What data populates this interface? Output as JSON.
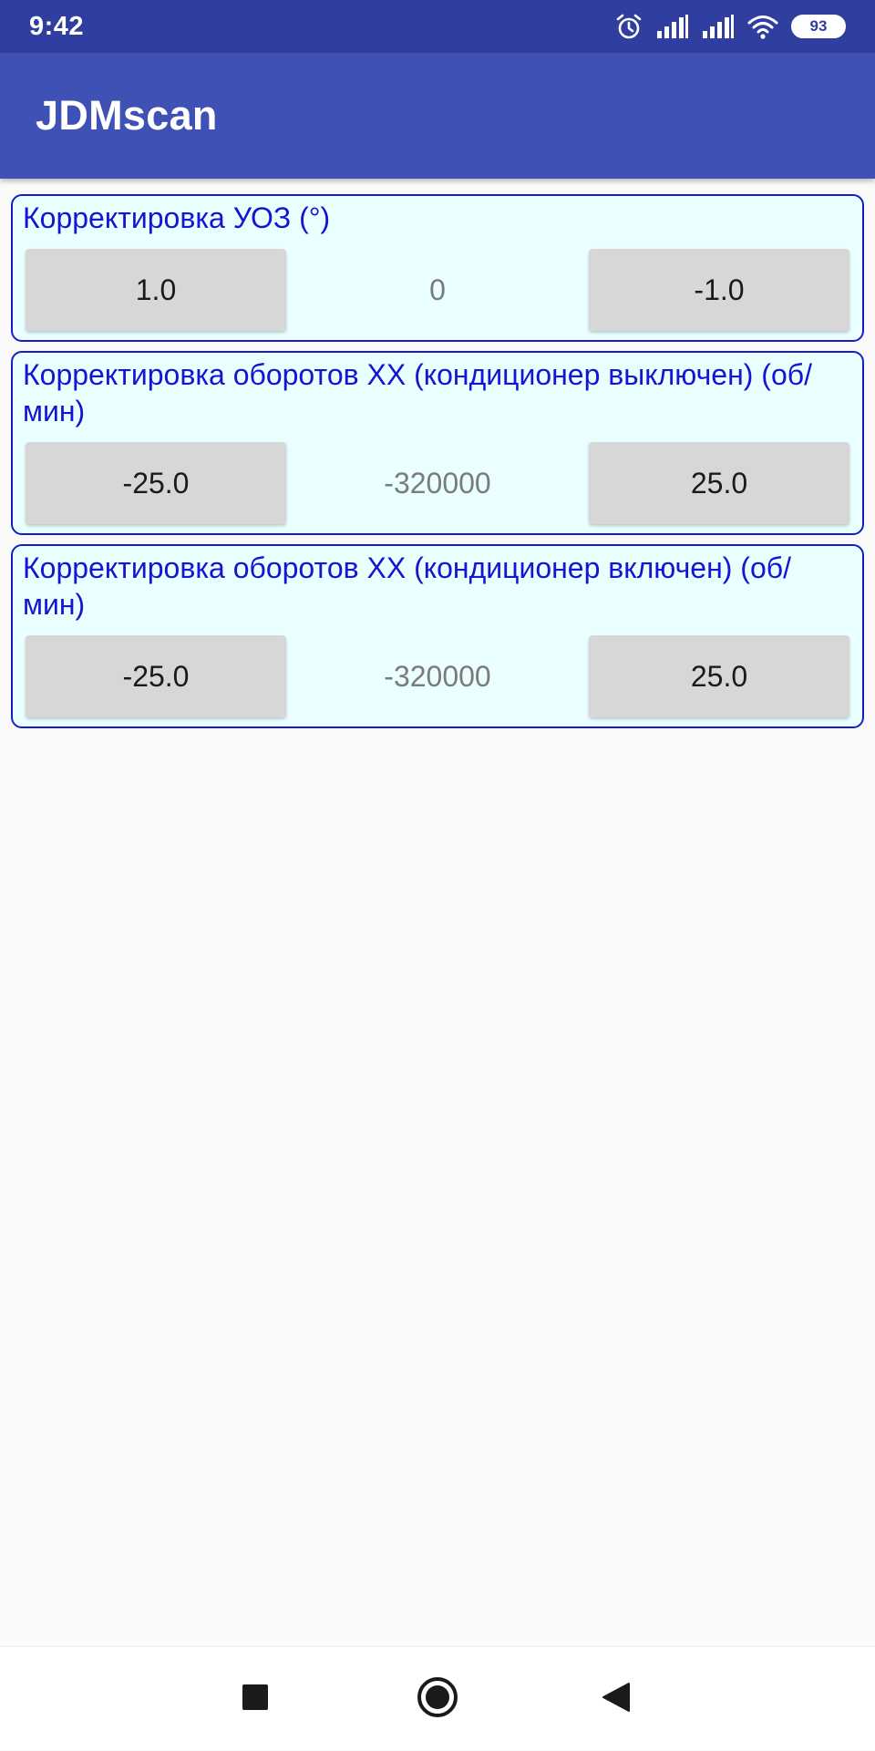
{
  "status_bar": {
    "time": "9:42",
    "battery": "93",
    "icons": [
      "alarm-icon",
      "signal-icon",
      "signal-icon",
      "wifi-icon",
      "battery-icon"
    ]
  },
  "app_bar": {
    "title": "JDMscan"
  },
  "panels": [
    {
      "label": "Корректировка УОЗ (°)",
      "left_button": "1.0",
      "value": "0",
      "right_button": "-1.0"
    },
    {
      "label": "Корректировка оборотов ХХ (кондиционер выключен) (об/мин)",
      "left_button": "-25.0",
      "value": "-320000",
      "right_button": "25.0"
    },
    {
      "label": "Корректировка оборотов ХХ (кондиционер включен) (об/мин)",
      "left_button": "-25.0",
      "value": "-320000",
      "right_button": "25.0"
    }
  ],
  "nav_bar": {
    "icons": [
      "recents-square-icon",
      "home-circle-icon",
      "back-triangle-icon"
    ]
  },
  "colors": {
    "status_bar": "#303f9f",
    "app_bar": "#3f51b5",
    "panel_background": "#eaffff",
    "panel_border": "#1a1acc",
    "panel_label": "#1414d2",
    "button": "#d7d7d7"
  }
}
